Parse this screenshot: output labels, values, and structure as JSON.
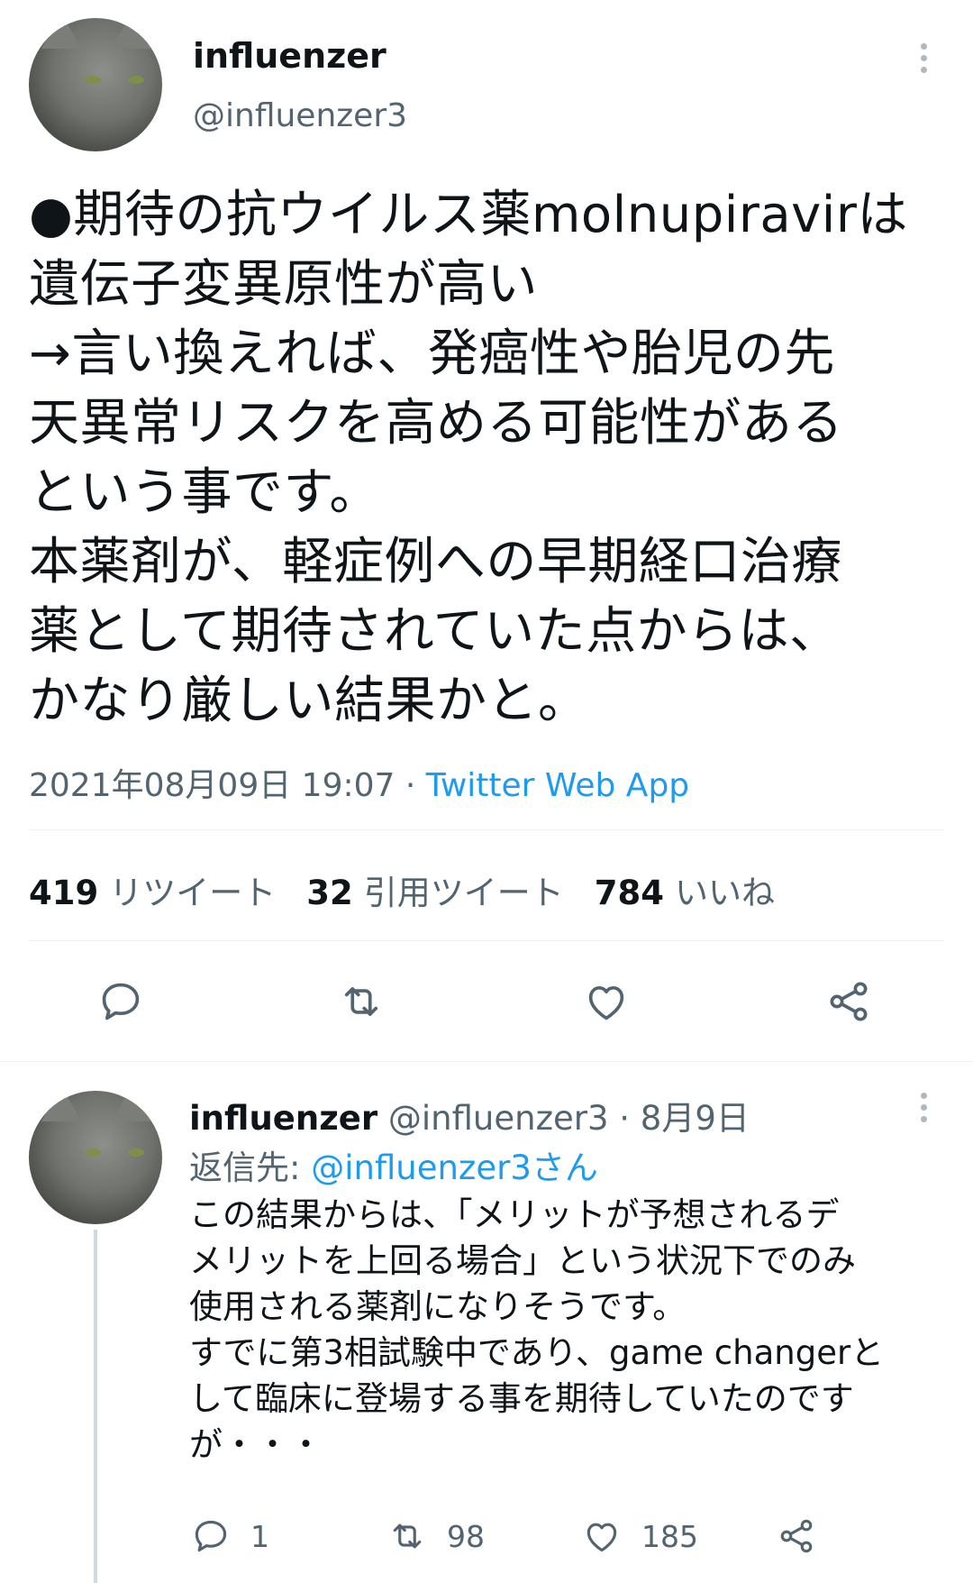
{
  "main_tweet": {
    "author": {
      "name": "influenzer",
      "handle": "@influenzer3"
    },
    "text": "●期待の抗ウイルス薬molnupiravirは\n遺伝子変異原性が高い\n→言い換えれば、発癌性や胎児の先\n天異常リスクを高める可能性がある\nという事です。\n本薬剤が、軽症例への早期経口治療\n薬として期待されていた点からは、\nかなり厳しい結果かと。",
    "timestamp": "2021年08月09日 19:07",
    "separator": " · ",
    "source_app": "Twitter Web App",
    "stats": {
      "retweets_count": "419",
      "retweets_label": "リツイート",
      "quotes_count": "32",
      "quotes_label": "引用ツイート",
      "likes_count": "784",
      "likes_label": "いいね"
    }
  },
  "reply_tweet": {
    "author": {
      "name": "influenzer",
      "handle": "@influenzer3",
      "date": "· 8月9日"
    },
    "reply_to_prefix": "返信先: ",
    "reply_to_handle": "@influenzer3さん",
    "text": "この結果からは、「メリットが予想されるデ\nメリットを上回る場合」という状況下でのみ\n使用される薬剤になりそうです。\nすでに第3相試験中であり、game changerと\nして臨床に登場する事を期待していたのです\nが・・・",
    "actions": {
      "reply_count": "1",
      "retweet_count": "98",
      "like_count": "185"
    }
  },
  "icons": {
    "more": "more-vertical-icon",
    "reply": "reply-bubble-icon",
    "retweet": "retweet-icon",
    "like": "heart-icon",
    "share": "share-icon"
  },
  "colors": {
    "accent": "#1d9bf0",
    "text": "#0f1419",
    "secondary": "#536471"
  }
}
